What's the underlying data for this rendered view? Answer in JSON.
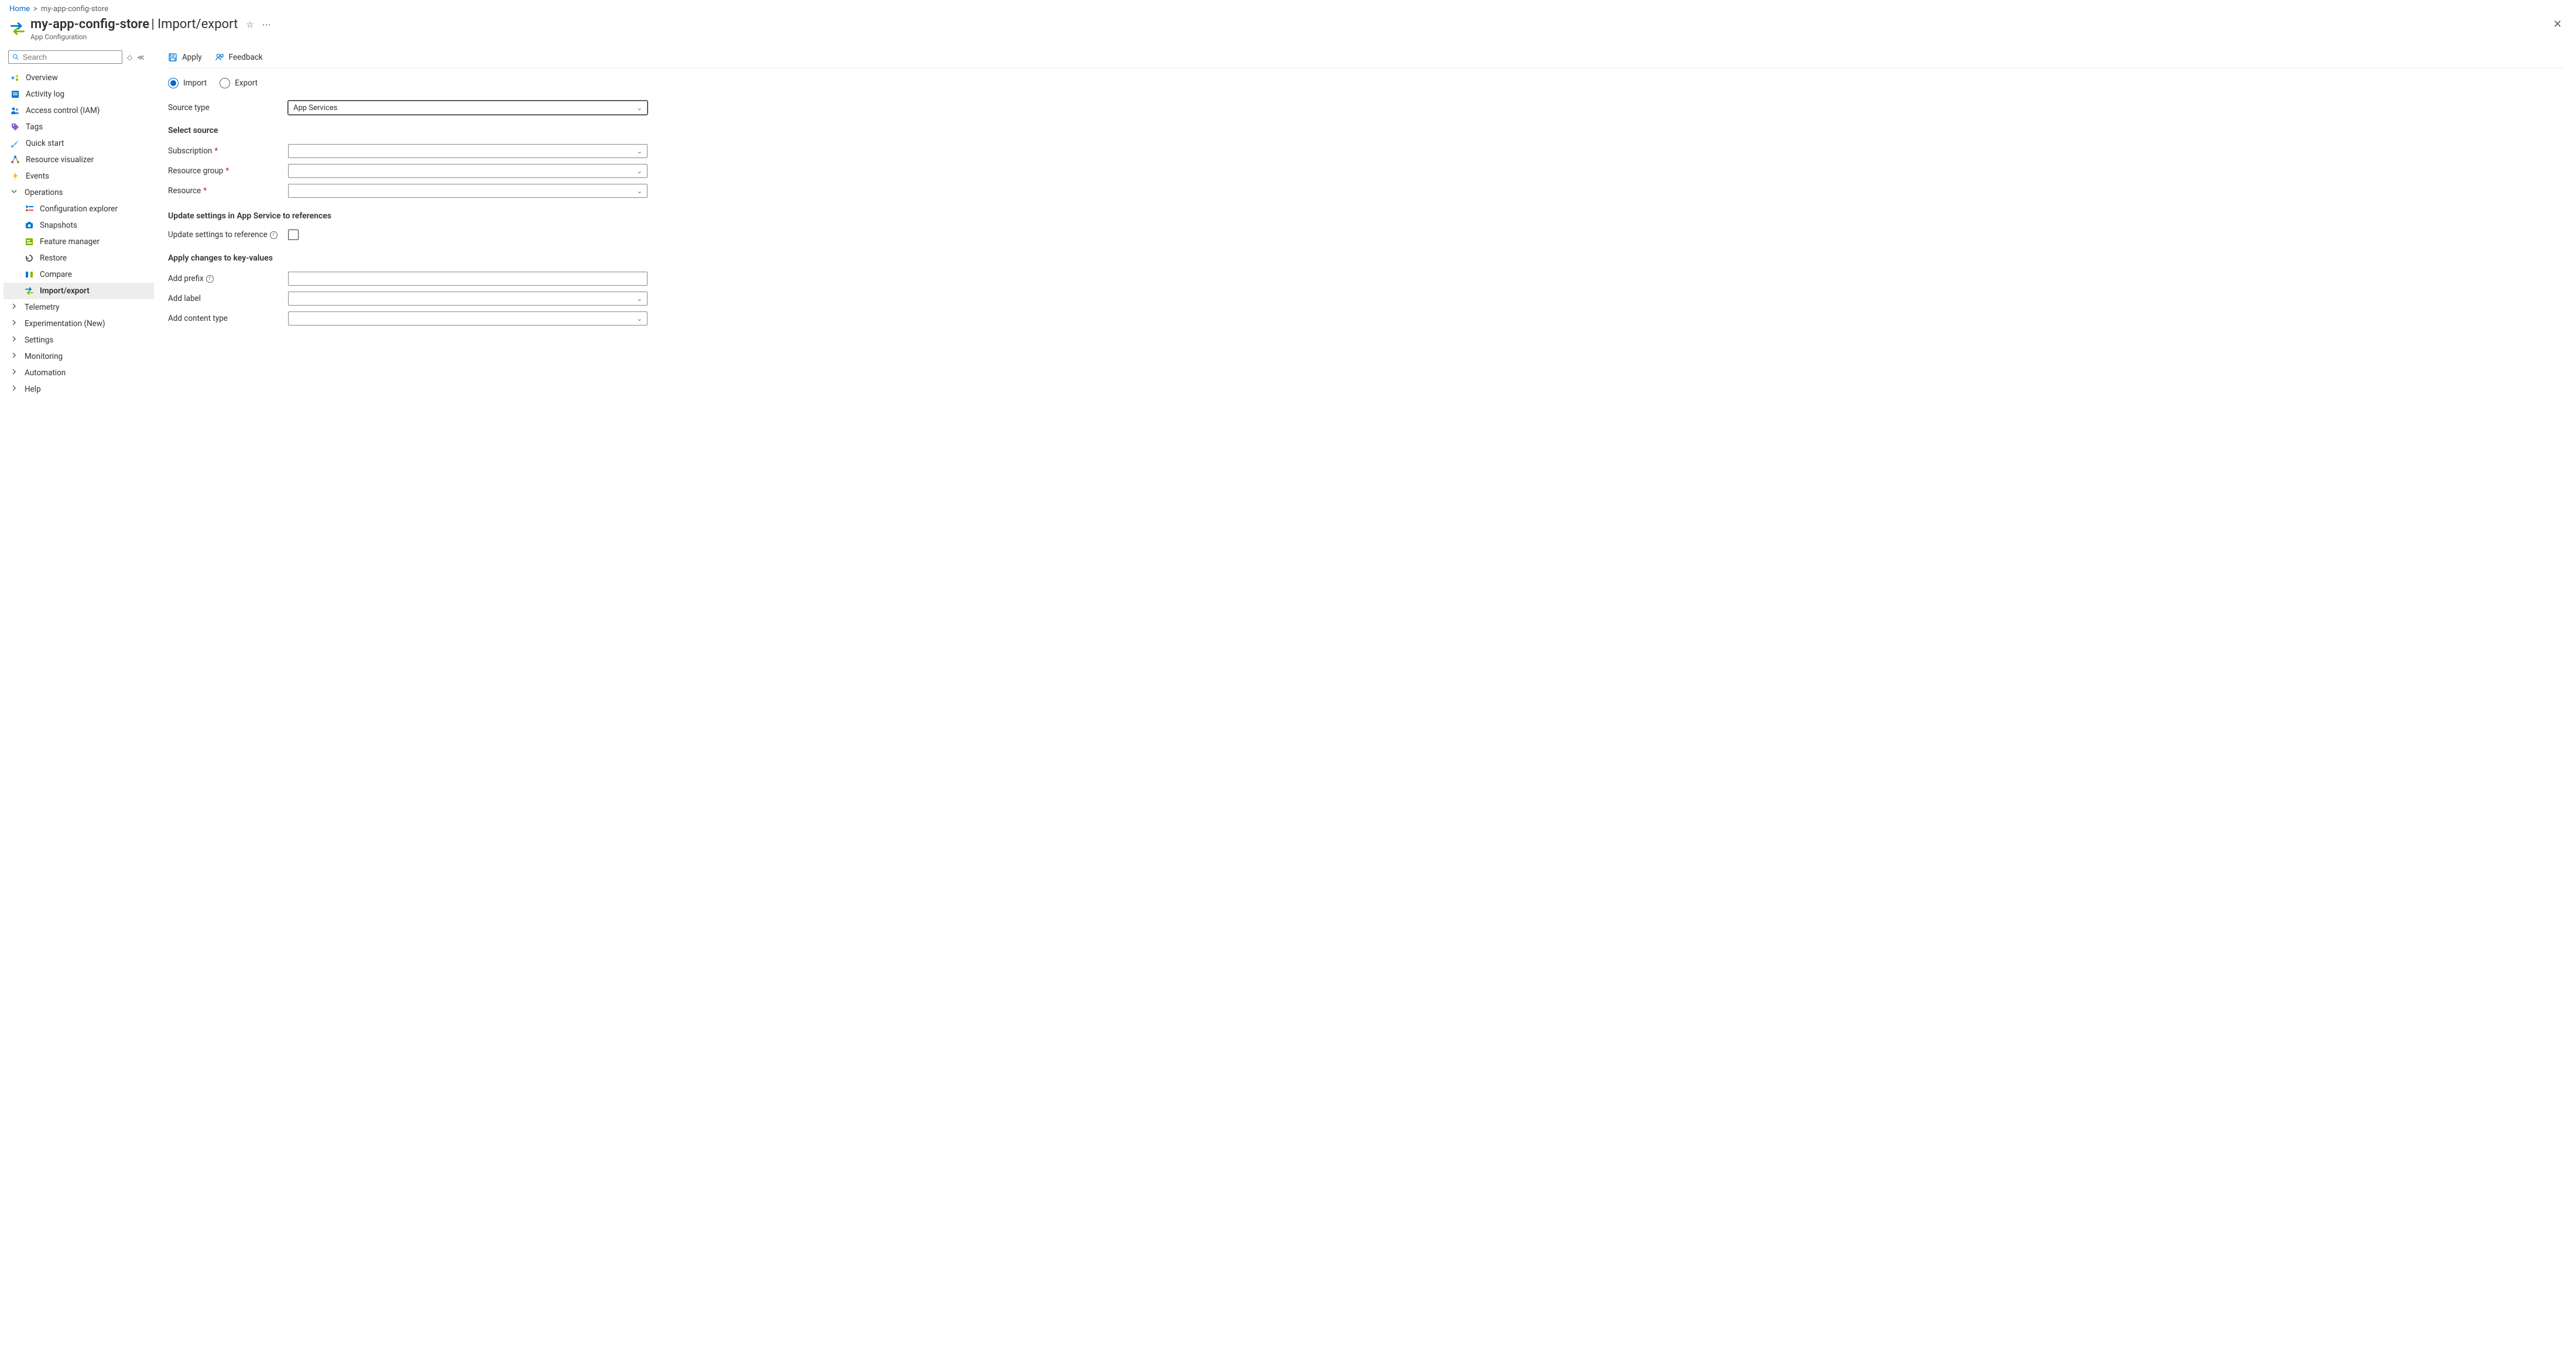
{
  "breadcrumb": {
    "home": "Home",
    "current": "my-app-config-store"
  },
  "header": {
    "title_resource": "my-app-config-store",
    "title_page": "Import/export",
    "subtitle": "App Configuration"
  },
  "search": {
    "placeholder": "Search"
  },
  "sidebar": {
    "items": [
      {
        "label": "Overview"
      },
      {
        "label": "Activity log"
      },
      {
        "label": "Access control (IAM)"
      },
      {
        "label": "Tags"
      },
      {
        "label": "Quick start"
      },
      {
        "label": "Resource visualizer"
      },
      {
        "label": "Events"
      },
      {
        "label": "Operations"
      },
      {
        "label": "Configuration explorer"
      },
      {
        "label": "Snapshots"
      },
      {
        "label": "Feature manager"
      },
      {
        "label": "Restore"
      },
      {
        "label": "Compare"
      },
      {
        "label": "Import/export"
      },
      {
        "label": "Telemetry"
      },
      {
        "label": "Experimentation (New)"
      },
      {
        "label": "Settings"
      },
      {
        "label": "Monitoring"
      },
      {
        "label": "Automation"
      },
      {
        "label": "Help"
      }
    ]
  },
  "toolbar": {
    "apply": "Apply",
    "feedback": "Feedback"
  },
  "radio": {
    "import": "Import",
    "export": "Export"
  },
  "form": {
    "source_type_label": "Source type",
    "source_type_value": "App Services",
    "section_select_source": "Select source",
    "subscription_label": "Subscription",
    "resource_group_label": "Resource group",
    "resource_label": "Resource",
    "section_update": "Update settings in App Service to references",
    "update_ref_label": "Update settings to reference",
    "section_apply_changes": "Apply changes to key-values",
    "add_prefix_label": "Add prefix",
    "add_label_label": "Add label",
    "add_content_type_label": "Add content type"
  }
}
